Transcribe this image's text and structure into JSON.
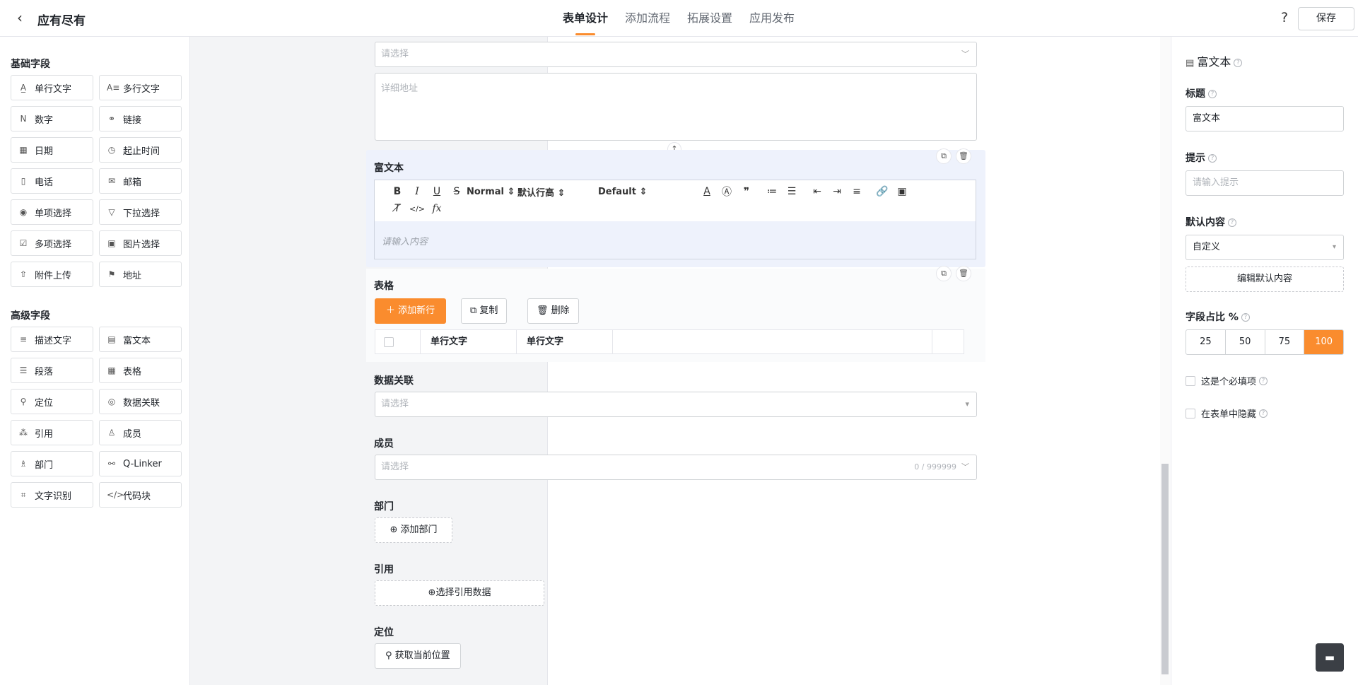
{
  "header": {
    "back_icon": "chevron-left-icon",
    "app_title": "应有尽有",
    "tabs": [
      {
        "label": "表单设计",
        "active": true
      },
      {
        "label": "添加流程",
        "active": false
      },
      {
        "label": "拓展设置",
        "active": false
      },
      {
        "label": "应用发布",
        "active": false
      }
    ],
    "help": "?",
    "save_label": "保存"
  },
  "left_panel": {
    "basic_title": "基础字段",
    "basic_fields": [
      {
        "label": "单行文字",
        "icon": "text-icon"
      },
      {
        "label": "多行文字",
        "icon": "multiline-text-icon"
      },
      {
        "label": "数字",
        "icon": "number-icon"
      },
      {
        "label": "链接",
        "icon": "link-icon"
      },
      {
        "label": "日期",
        "icon": "calendar-icon"
      },
      {
        "label": "起止时间",
        "icon": "clock-icon"
      },
      {
        "label": "电话",
        "icon": "phone-icon"
      },
      {
        "label": "邮箱",
        "icon": "mail-icon"
      },
      {
        "label": "单项选择",
        "icon": "radio-icon"
      },
      {
        "label": "下拉选择",
        "icon": "dropdown-icon"
      },
      {
        "label": "多项选择",
        "icon": "checkbox-icon"
      },
      {
        "label": "图片选择",
        "icon": "image-icon"
      },
      {
        "label": "附件上传",
        "icon": "upload-icon"
      },
      {
        "label": "地址",
        "icon": "location-icon"
      }
    ],
    "advanced_title": "高级字段",
    "advanced_fields": [
      {
        "label": "描述文字",
        "icon": "description-icon"
      },
      {
        "label": "富文本",
        "icon": "rich-text-icon"
      },
      {
        "label": "段落",
        "icon": "paragraph-icon"
      },
      {
        "label": "表格",
        "icon": "table-icon"
      },
      {
        "label": "定位",
        "icon": "pin-icon"
      },
      {
        "label": "数据关联",
        "icon": "data-link-icon"
      },
      {
        "label": "引用",
        "icon": "reference-icon"
      },
      {
        "label": "成员",
        "icon": "user-icon"
      },
      {
        "label": "部门",
        "icon": "department-icon"
      },
      {
        "label": "Q-Linker",
        "icon": "q-linker-icon"
      },
      {
        "label": "文字识别",
        "icon": "ocr-icon"
      },
      {
        "label": "代码块",
        "icon": "code-icon"
      }
    ]
  },
  "canvas": {
    "address_select_placeholder": "请选择",
    "address_detail_placeholder": "详细地址",
    "richtext": {
      "label": "富文本",
      "header_select": "Normal",
      "line_height_select": "默认行高",
      "font_select": "Default",
      "editor_placeholder": "请输入内容"
    },
    "table": {
      "label": "表格",
      "add_row": "添加新行",
      "copy": "复制",
      "delete": "删除",
      "columns": [
        "单行文字",
        "单行文字"
      ]
    },
    "data_link": {
      "label": "数据关联",
      "placeholder": "请选择"
    },
    "member": {
      "label": "成员",
      "placeholder": "请选择",
      "count": "0 / 999999"
    },
    "department": {
      "label": "部门",
      "button": "添加部门"
    },
    "reference": {
      "label": "引用",
      "button": "选择引用数据"
    },
    "location": {
      "label": "定位",
      "button": "获取当前位置"
    }
  },
  "right_panel": {
    "title": "富文本",
    "title_label": "标题",
    "title_value": "富文本",
    "hint_label": "提示",
    "hint_placeholder": "请输入提示",
    "default_label": "默认内容",
    "default_value": "自定义",
    "edit_default": "编辑默认内容",
    "ratio_label": "字段占比 %",
    "ratio_options": [
      "25",
      "50",
      "75",
      "100"
    ],
    "ratio_selected": "100",
    "required_label": "这是个必填项",
    "hidden_label": "在表单中隐藏"
  },
  "colors": {
    "accent": "#fa8c2e",
    "selected_block": "#eef2fc"
  }
}
